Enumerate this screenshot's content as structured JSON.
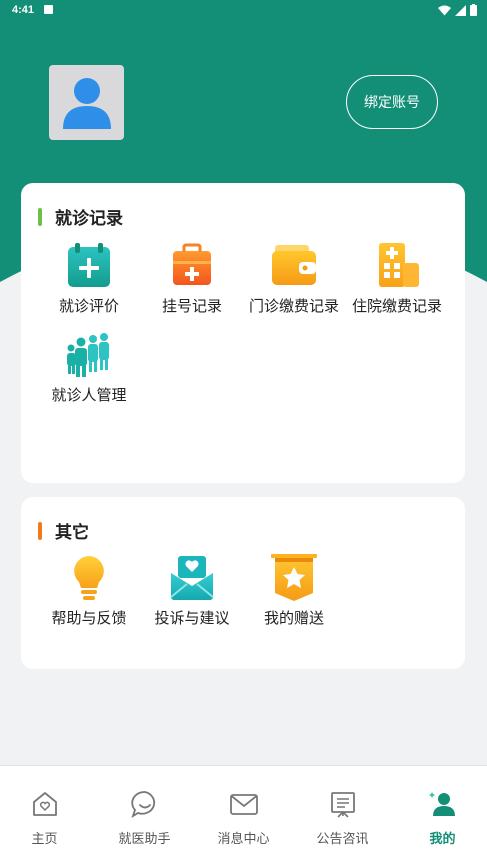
{
  "status_bar": {
    "time": "4:41"
  },
  "header": {
    "bind_account_label": "绑定账号"
  },
  "visit_records": {
    "title": "就诊记录",
    "accent": "#6cc04a",
    "items": [
      {
        "label": "就诊评价",
        "icon": "calendar-plus-icon"
      },
      {
        "label": "挂号记录",
        "icon": "medical-kit-icon"
      },
      {
        "label": "门诊缴费记录",
        "icon": "wallet-icon"
      },
      {
        "label": "住院缴费记录",
        "icon": "hospital-building-icon"
      },
      {
        "label": "就诊人管理",
        "icon": "family-group-icon"
      }
    ]
  },
  "others": {
    "title": "其它",
    "accent": "#f07a1b",
    "items": [
      {
        "label": "帮助与反馈",
        "icon": "lightbulb-icon"
      },
      {
        "label": "投诉与建议",
        "icon": "heart-mail-icon"
      },
      {
        "label": "我的赠送",
        "icon": "star-banner-icon"
      }
    ]
  },
  "tabbar": {
    "items": [
      {
        "label": "主页",
        "icon": "home-icon"
      },
      {
        "label": "就医助手",
        "icon": "chat-bubble-icon"
      },
      {
        "label": "消息中心",
        "icon": "mail-icon"
      },
      {
        "label": "公告咨讯",
        "icon": "notice-board-icon"
      },
      {
        "label": "我的",
        "icon": "user-icon",
        "active": true
      }
    ]
  },
  "colors": {
    "brand": "#138f78",
    "background": "#f1f2f4"
  }
}
